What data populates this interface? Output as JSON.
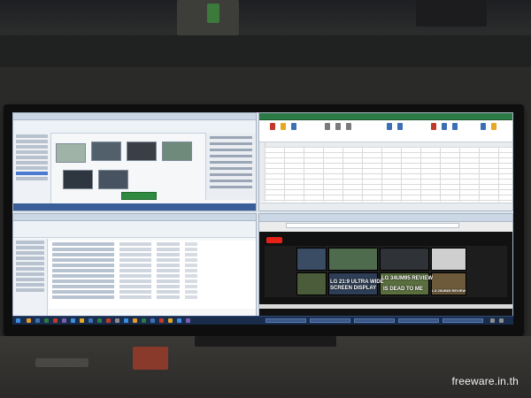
{
  "scene": {
    "description_free": true
  },
  "screen_content": {
    "youtube_captions": [
      {
        "text": "LG 21:9 ULTRA WIDE"
      },
      {
        "text": "SCREEN DISPLAY"
      },
      {
        "text": "LG 34UM95 REVIEW"
      },
      {
        "text": "LG 29UB65 REVIEW"
      },
      {
        "text": "IS DEAD TO ME"
      }
    ]
  },
  "watermark": {
    "text": "freeware.in.th"
  },
  "colors": {
    "taskbar": "#1a2c4b",
    "photo_statusbar": "#3a5e9a",
    "youtube_red": "#e62117",
    "excel_green_button": "#2f8a3f"
  },
  "icons": [
    "folder-icon",
    "excel-icon",
    "browser-icon",
    "youtube-logo-icon",
    "start-icon"
  ]
}
